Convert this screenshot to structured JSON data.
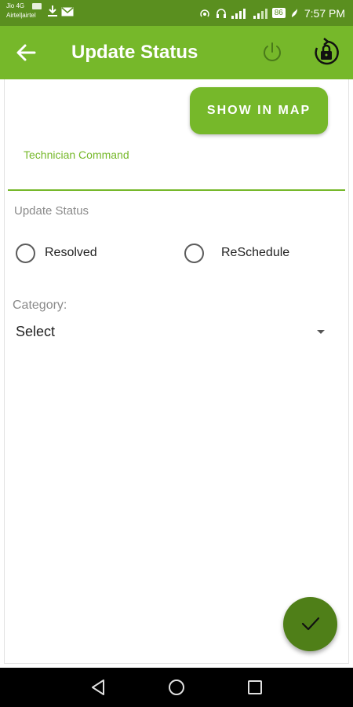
{
  "status_bar": {
    "carrier_1": "Jio 4G",
    "carrier_2": "Airtel|airtel",
    "battery": "86",
    "time": "7:57 PM",
    "icons": [
      "volte-icon",
      "download-icon",
      "mail-icon",
      "hotspot-icon",
      "headset-icon",
      "signal-icon",
      "battery-icon",
      "saver-icon"
    ]
  },
  "app_bar": {
    "title": "Update Status",
    "background": "#76b82a",
    "icons": [
      "back-arrow-icon",
      "power-icon",
      "lock-sync-icon"
    ]
  },
  "form": {
    "map_button_label": "SHOW IN MAP",
    "technician_label": "Technician Command",
    "update_status_label": "Update Status",
    "radio_options": [
      {
        "label": "Resolved",
        "selected": false
      },
      {
        "label": "ReSchedule",
        "selected": false
      }
    ],
    "category_label": "Category:",
    "category_value": "Select"
  },
  "fab": {
    "icon": "checkmark-icon",
    "color": "#4f7f18"
  },
  "nav_bar": {
    "icons": [
      "nav-back-icon",
      "nav-home-icon",
      "nav-recents-icon"
    ]
  }
}
